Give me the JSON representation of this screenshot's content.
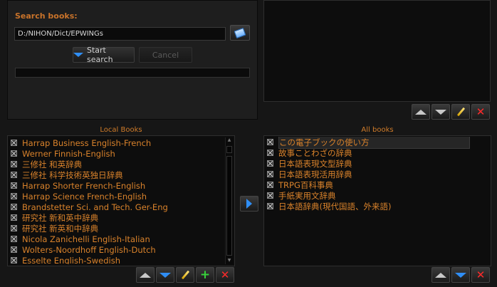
{
  "search": {
    "title": "Search books:",
    "path_value": "D:/NIHON/Dict/EPWINGs",
    "start_label": "Start search",
    "cancel_label": "Cancel"
  },
  "local_books": {
    "label": "Local Books",
    "items": [
      "Harrap Business English-French",
      "Werner Finnish-English",
      "三修社 和英辞典",
      "三修社 科学技術英独日辞典",
      "Harrap Shorter French-English",
      "Harrap Science French-English",
      "Brandstetter Sci. and Tech. Ger-Eng",
      "研究社 新和英中辞典",
      "研究社 新英和中辞典",
      "Nicola Zanichelli English-Italian",
      "Wolters-Noordhoff English-Dutch",
      "Esselte English-Swedish"
    ]
  },
  "all_books": {
    "label": "All books",
    "items": [
      "この電子ブックの使い方",
      "故事ことわざの辞典",
      "日本語表現文型辞典",
      "日本語表現活用辞典",
      "TRPG百科事典",
      "手紙実用文辞典",
      "日本語辞典(現代国語、外来語)"
    ]
  },
  "icons": {
    "browse": "folder-icon",
    "move_up": "arrow-up-icon",
    "move_down": "arrow-down-icon",
    "edit": "pencil-icon",
    "add": "plus-icon",
    "remove": "close-icon",
    "transfer": "arrow-right-icon"
  },
  "colors": {
    "accent_text": "#d9822b",
    "background": "#161616",
    "blue_arrow": "#2f8ef5",
    "remove_red": "#ff2a2a",
    "add_green": "#37d13a"
  }
}
